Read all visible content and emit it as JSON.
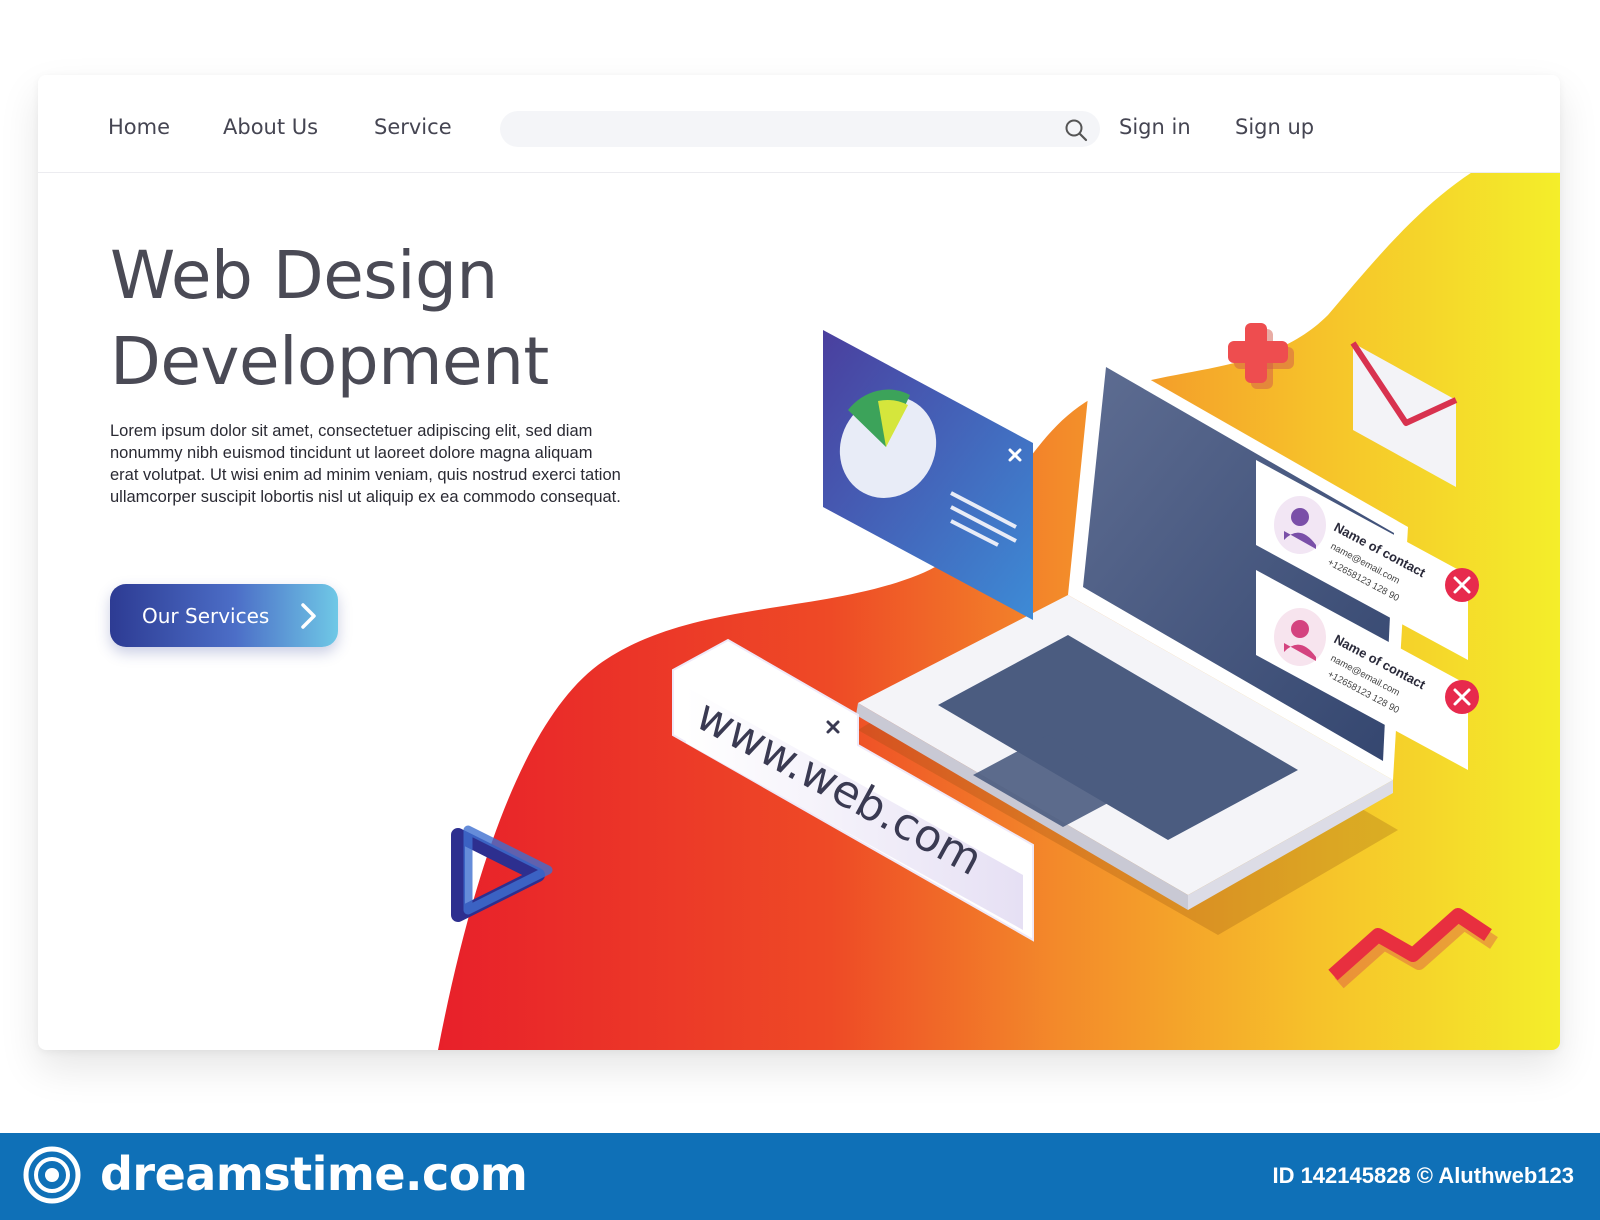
{
  "nav": {
    "links": [
      "Home",
      "About Us",
      "Service"
    ],
    "search_value": "",
    "sign_in": "Sign in",
    "sign_up": "Sign up"
  },
  "hero": {
    "title_line1": "Web Design",
    "title_line2": "Development",
    "body_lines": [
      "Lorem ipsum dolor sit amet, consectetuer adipiscing elit, sed diam",
      "nonummy nibh euismod tincidunt ut laoreet dolore magna aliquam",
      "erat volutpat. Ut wisi enim ad minim veniam, quis nostrud exerci tation",
      "ullamcorper suscipit lobortis nisl ut aliquip ex ea commodo consequat."
    ],
    "cta_label": "Our Services"
  },
  "illustration": {
    "url_text": "www.web.com",
    "contacts": [
      {
        "name": "Name of contact",
        "email": "name@email.com",
        "phone": "+12658123 128 90"
      },
      {
        "name": "Name of contact",
        "email": "name@email.com",
        "phone": "+12658123 128 90"
      }
    ]
  },
  "watermark": {
    "site": "dreamstime.com",
    "id_text": "ID 142145828 © Aluthweb123"
  },
  "colors": {
    "accent_blue": "#2d3b93",
    "accent_cyan": "#6fc8e6",
    "blob_red": "#e8202a",
    "blob_orange": "#f3892a",
    "blob_yellow": "#f4e82a",
    "watermark_bar": "#0f70b7"
  }
}
